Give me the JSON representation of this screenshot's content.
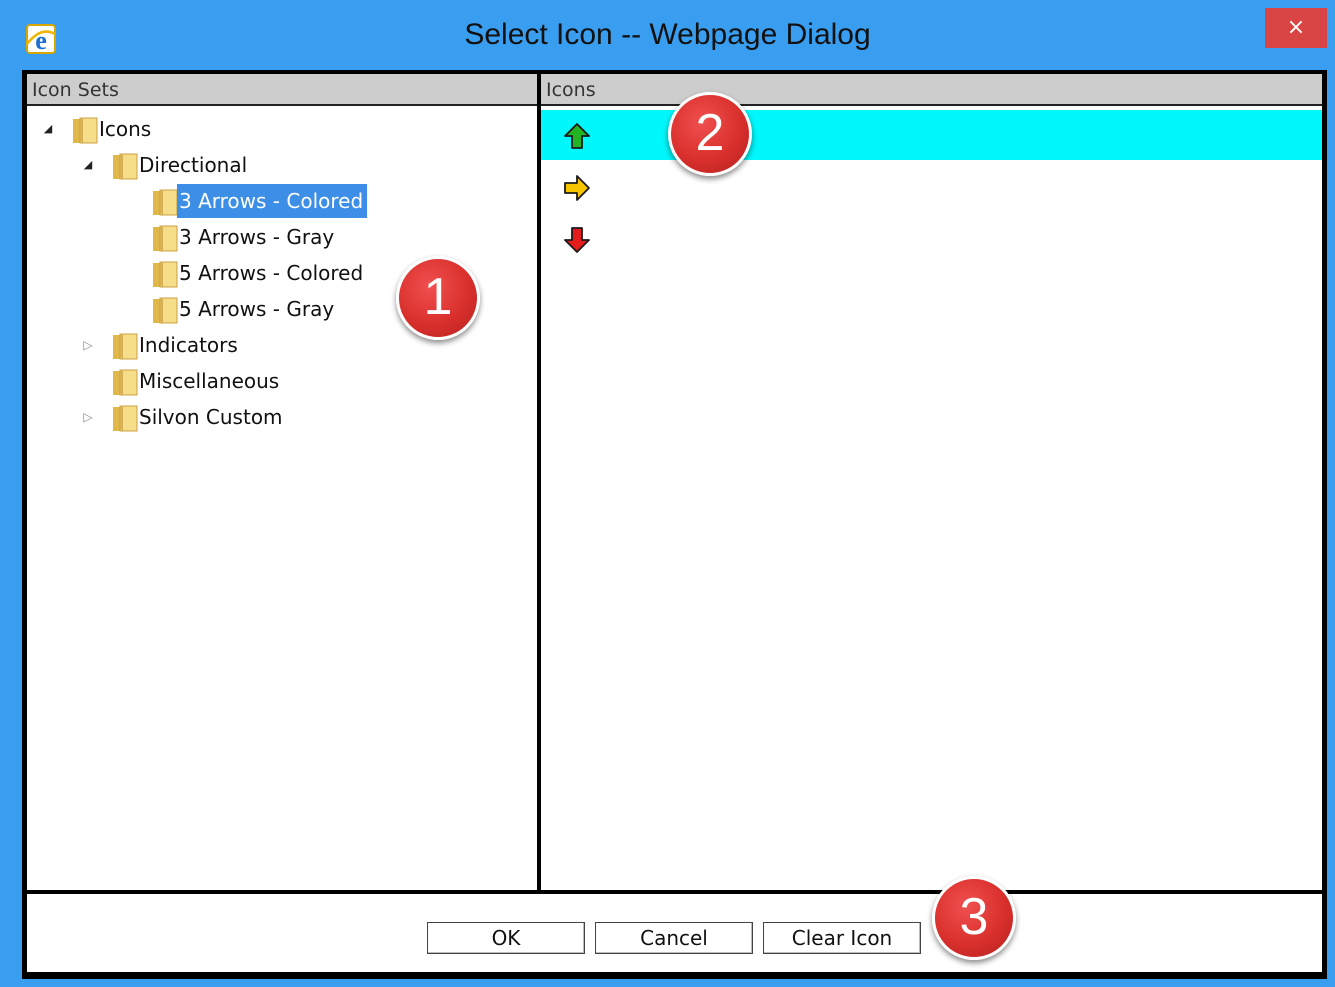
{
  "window": {
    "title": "Select Icon -- Webpage Dialog",
    "close_label": "×",
    "app_icon": "internet-explorer-icon"
  },
  "left_pane": {
    "header": "Icon Sets",
    "tree": [
      {
        "label": "Icons",
        "level": 0,
        "toggle": "expanded",
        "selected": false
      },
      {
        "label": "Directional",
        "level": 1,
        "toggle": "expanded",
        "selected": false
      },
      {
        "label": "3 Arrows - Colored",
        "level": 2,
        "toggle": "none",
        "selected": true
      },
      {
        "label": "3 Arrows - Gray",
        "level": 2,
        "toggle": "none",
        "selected": false
      },
      {
        "label": "5 Arrows - Colored",
        "level": 2,
        "toggle": "none",
        "selected": false
      },
      {
        "label": "5 Arrows - Gray",
        "level": 2,
        "toggle": "none",
        "selected": false
      },
      {
        "label": "Indicators",
        "level": 1,
        "toggle": "collapsed",
        "selected": false
      },
      {
        "label": "Miscellaneous",
        "level": 1,
        "toggle": "none",
        "selected": false
      },
      {
        "label": "Silvon Custom",
        "level": 1,
        "toggle": "collapsed",
        "selected": false
      }
    ]
  },
  "right_pane": {
    "header": "Icons",
    "icons": [
      {
        "name": "green-up-arrow-icon",
        "color": "#22b422",
        "direction": "up",
        "selected": true
      },
      {
        "name": "yellow-right-arrow-icon",
        "color": "#f7c400",
        "direction": "right",
        "selected": false
      },
      {
        "name": "red-down-arrow-icon",
        "color": "#e51c1c",
        "direction": "down",
        "selected": false
      }
    ]
  },
  "buttons": {
    "ok": "OK",
    "cancel": "Cancel",
    "clear_icon": "Clear Icon"
  },
  "callouts": [
    "1",
    "2",
    "3"
  ],
  "colors": {
    "titlebar": "#3a9ef0",
    "tree_selection": "#3d8ee6",
    "icon_selection": "#00f7fb",
    "callout": "#d9302c"
  }
}
